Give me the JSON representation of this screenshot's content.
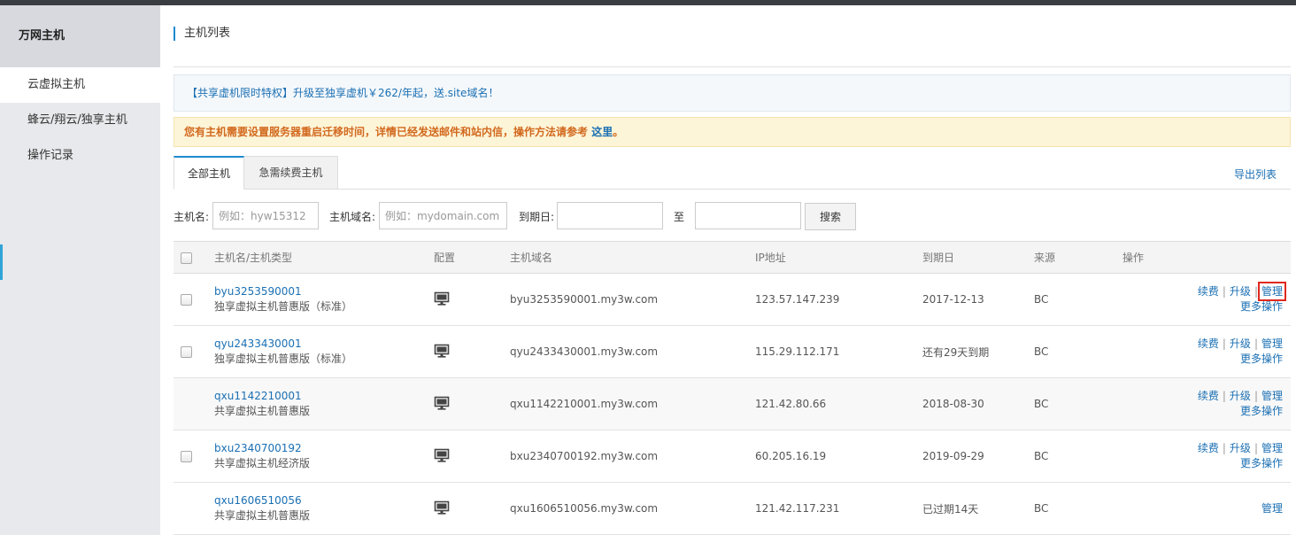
{
  "sidebar": {
    "title": "万网主机",
    "items": [
      {
        "label": "云虚拟主机"
      },
      {
        "label": "蜂云/翔云/独享主机"
      },
      {
        "label": "操作记录"
      }
    ]
  },
  "page": {
    "title": "主机列表"
  },
  "promo": {
    "text": "【共享虚机限时特权】升级至独享虚机￥262/年起，送.site域名！"
  },
  "notice": {
    "text": "您有主机需要设置服务器重启迁移时间，详情已经发送邮件和站内信，操作方法请参考 ",
    "link": "这里",
    "end": "。"
  },
  "tabs": [
    {
      "label": "全部主机"
    },
    {
      "label": "急需续费主机"
    }
  ],
  "export_label": "导出列表",
  "filters": {
    "name_label": "主机名:",
    "name_placeholder": "例如：hyw15312",
    "domain_label": "主机域名:",
    "domain_placeholder": "例如：mydomain.com",
    "expiry_label": "到期日:",
    "to_label": "至",
    "search_label": "搜索"
  },
  "table": {
    "headers": {
      "name": "主机名/主机类型",
      "config": "配置",
      "domain": "主机域名",
      "ip": "IP地址",
      "expiry": "到期日",
      "source": "来源",
      "actions": "操作"
    },
    "rows": [
      {
        "name": "byu3253590001",
        "type": "独享虚拟主机普惠版（标准）",
        "domain": "byu3253590001.my3w.com",
        "ip": "123.57.147.239",
        "expiry": "2017-12-13",
        "source": "BC",
        "renew": "续费",
        "upgrade": "升级",
        "manage": "管理",
        "more": "更多操作"
      },
      {
        "name": "qyu2433430001",
        "type": "独享虚拟主机普惠版（标准）",
        "domain": "qyu2433430001.my3w.com",
        "ip": "115.29.112.171",
        "expiry": "还有29天到期",
        "source": "BC",
        "renew": "续费",
        "upgrade": "升级",
        "manage": "管理",
        "more": "更多操作"
      },
      {
        "name": "qxu1142210001",
        "type": "共享虚拟主机普惠版",
        "domain": "qxu1142210001.my3w.com",
        "ip": "121.42.80.66",
        "expiry": "2018-08-30",
        "source": "BC",
        "renew": "续费",
        "upgrade": "升级",
        "manage": "管理",
        "more": "更多操作"
      },
      {
        "name": "bxu2340700192",
        "type": "共享虚拟主机经济版",
        "domain": "bxu2340700192.my3w.com",
        "ip": "60.205.16.19",
        "expiry": "2019-09-29",
        "source": "BC",
        "renew": "续费",
        "upgrade": "升级",
        "manage": "管理",
        "more": "更多操作"
      },
      {
        "name": "qxu1606510056",
        "type": "共享虚拟主机普惠版",
        "domain": "qxu1606510056.my3w.com",
        "ip": "121.42.117.231",
        "expiry": "已过期14天",
        "source": "BC",
        "manage": "管理"
      }
    ]
  },
  "colors": {
    "link": "#1a6fb3",
    "warning_text": "#d2691e",
    "expired": "#e0281d",
    "highlight_box": "#e0281d"
  },
  "icons": {
    "config": "monitor-icon"
  }
}
